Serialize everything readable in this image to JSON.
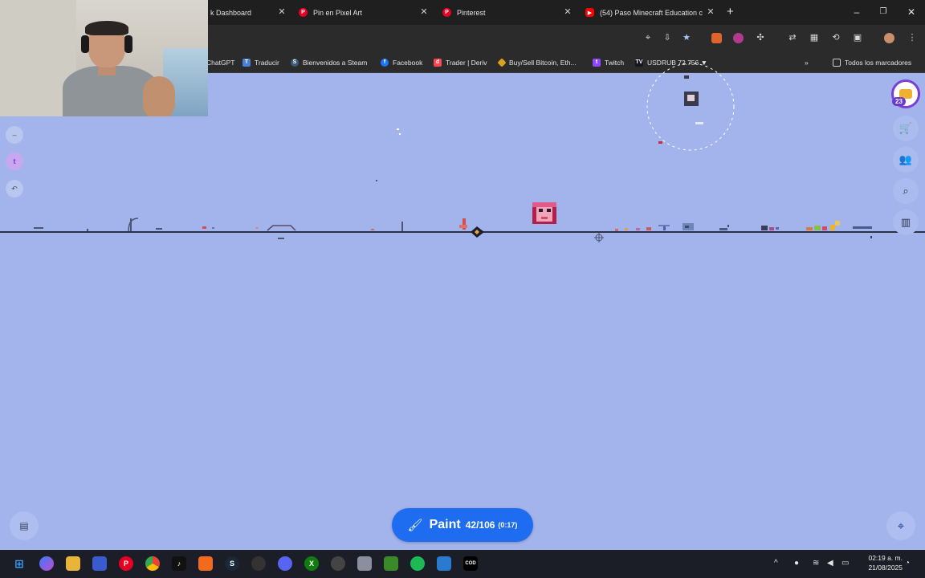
{
  "tabs": [
    {
      "title": "k Dashboard",
      "icon": "dashboard-icon"
    },
    {
      "title": "Pin en Pixel Art",
      "icon": "pinterest-icon"
    },
    {
      "title": "Pinterest",
      "icon": "pinterest-icon"
    },
    {
      "title": "(54) Paso Minecraft Education c",
      "icon": "youtube-icon"
    }
  ],
  "window_controls": {
    "minimize": "–",
    "maximize": "❐",
    "close": "✕",
    "new_tab": "+"
  },
  "bookmarks": [
    {
      "label": "ChatGPT",
      "icon": "chatgpt-icon"
    },
    {
      "label": "Traducir",
      "icon": "translate-icon"
    },
    {
      "label": "Bienvenidos a Steam",
      "icon": "steam-icon"
    },
    {
      "label": "Facebook",
      "icon": "facebook-icon"
    },
    {
      "label": "Trader | Deriv",
      "icon": "deriv-icon"
    },
    {
      "label": "Buy/Sell Bitcoin, Eth...",
      "icon": "binance-icon"
    },
    {
      "label": "Twitch",
      "icon": "twitch-icon"
    },
    {
      "label": "USDRUB 72.756 ▼",
      "icon": "tradingview-icon"
    }
  ],
  "bookmarks_overflow": "»",
  "all_bookmarks": "Todos los marcadores",
  "canvas": {
    "background_color": "#a3b4ec",
    "user_level": "23",
    "paint_button": {
      "label": "Paint",
      "count": "42/106",
      "timer": "(0:17)"
    }
  },
  "taskbar": {
    "time": "02:19 a. m.",
    "date": "21/08/2025"
  }
}
